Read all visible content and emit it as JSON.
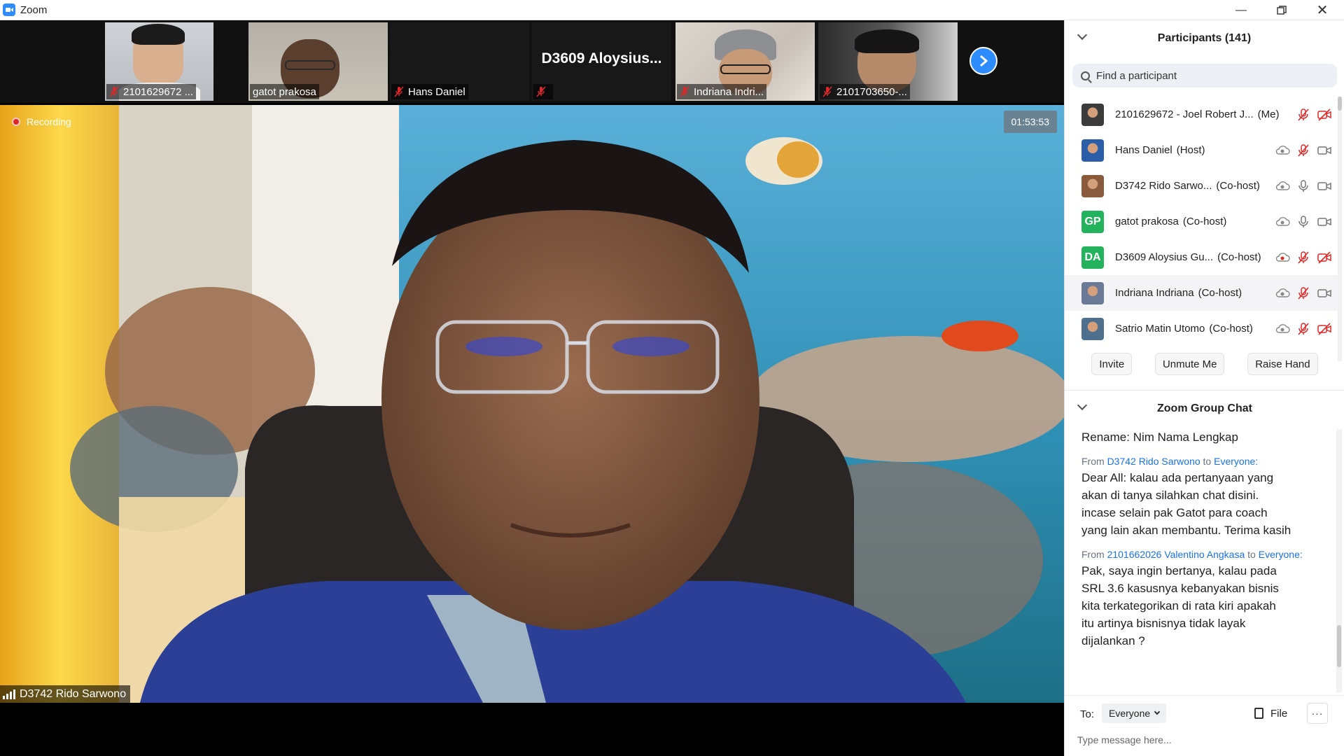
{
  "window": {
    "title": "Zoom"
  },
  "thumbnails": [
    {
      "name": "2101629672 ...",
      "muted": true
    },
    {
      "name": "gatot prakosa",
      "muted": false
    },
    {
      "name": "Hans Daniel",
      "muted": true
    },
    {
      "name": "",
      "big_name": "D3609  Aloysius...",
      "muted": true
    },
    {
      "name": "Indriana Indri...",
      "muted": true
    },
    {
      "name": "2101703650-...",
      "muted": true
    }
  ],
  "main_video": {
    "recording_label": "Recording",
    "timer": "01:53:53",
    "speaker_name": "D3742 Rido Sarwono"
  },
  "participants_panel": {
    "title": "Participants (141)",
    "search_placeholder": "Find a participant",
    "items": [
      {
        "name": "2101629672 - Joel Robert J...",
        "role": "(Me)",
        "avatar": "photo",
        "avatar_color": "#3b3b3b"
      },
      {
        "name": "Hans Daniel",
        "role": "(Host)",
        "avatar": "photo",
        "avatar_color": "#2a5ea8"
      },
      {
        "name": "D3742 Rido Sarwo...",
        "role": "(Co-host)",
        "avatar": "photo",
        "avatar_color": "#8a5a3c"
      },
      {
        "name": "gatot prakosa",
        "role": "(Co-host)",
        "avatar": "GP",
        "avatar_color": "#23b35c"
      },
      {
        "name": "D3609 Aloysius Gu...",
        "role": "(Co-host)",
        "avatar": "DA",
        "avatar_color": "#23b35c"
      },
      {
        "name": "Indriana Indriana",
        "role": "(Co-host)",
        "avatar": "photo",
        "avatar_color": "#6a7a96"
      },
      {
        "name": "Satrio Matin Utomo",
        "role": "(Co-host)",
        "avatar": "photo",
        "avatar_color": "#4f6f8f"
      }
    ],
    "actions": [
      "Invite",
      "Unmute Me",
      "Raise Hand"
    ]
  },
  "chat": {
    "title": "Zoom Group Chat",
    "partial_line": "Rename: Nim Nama Lengkap",
    "messages": [
      {
        "from_label": "From",
        "sender": "D3742 Rido Sarwono",
        "to_label": "to",
        "recipient": "Everyone:",
        "lines": [
          "Dear All: kalau ada pertanyaan yang",
          "akan di tanya silahkan chat disini.",
          "incase selain pak Gatot para coach",
          "yang lain akan membantu. Terima kasih"
        ]
      },
      {
        "from_label": "From",
        "sender": "2101662026 Valentino Angkasa",
        "to_label": "to",
        "recipient": "Everyone:",
        "lines": [
          "Pak, saya ingin bertanya, kalau pada",
          "SRL 3.6 kasusnya kebanyakan bisnis",
          "kita terkategorikan di rata kiri apakah",
          "itu artinya bisnisnya tidak layak",
          "dijalankan ?"
        ]
      }
    ],
    "to_label": "To:",
    "to_value": "Everyone",
    "file_label": "File",
    "more_label": "···",
    "input_placeholder": "Type message here..."
  },
  "colors": {
    "accent": "#2d8cff",
    "muted_red": "#e02828",
    "green_avatar": "#23b35c"
  }
}
